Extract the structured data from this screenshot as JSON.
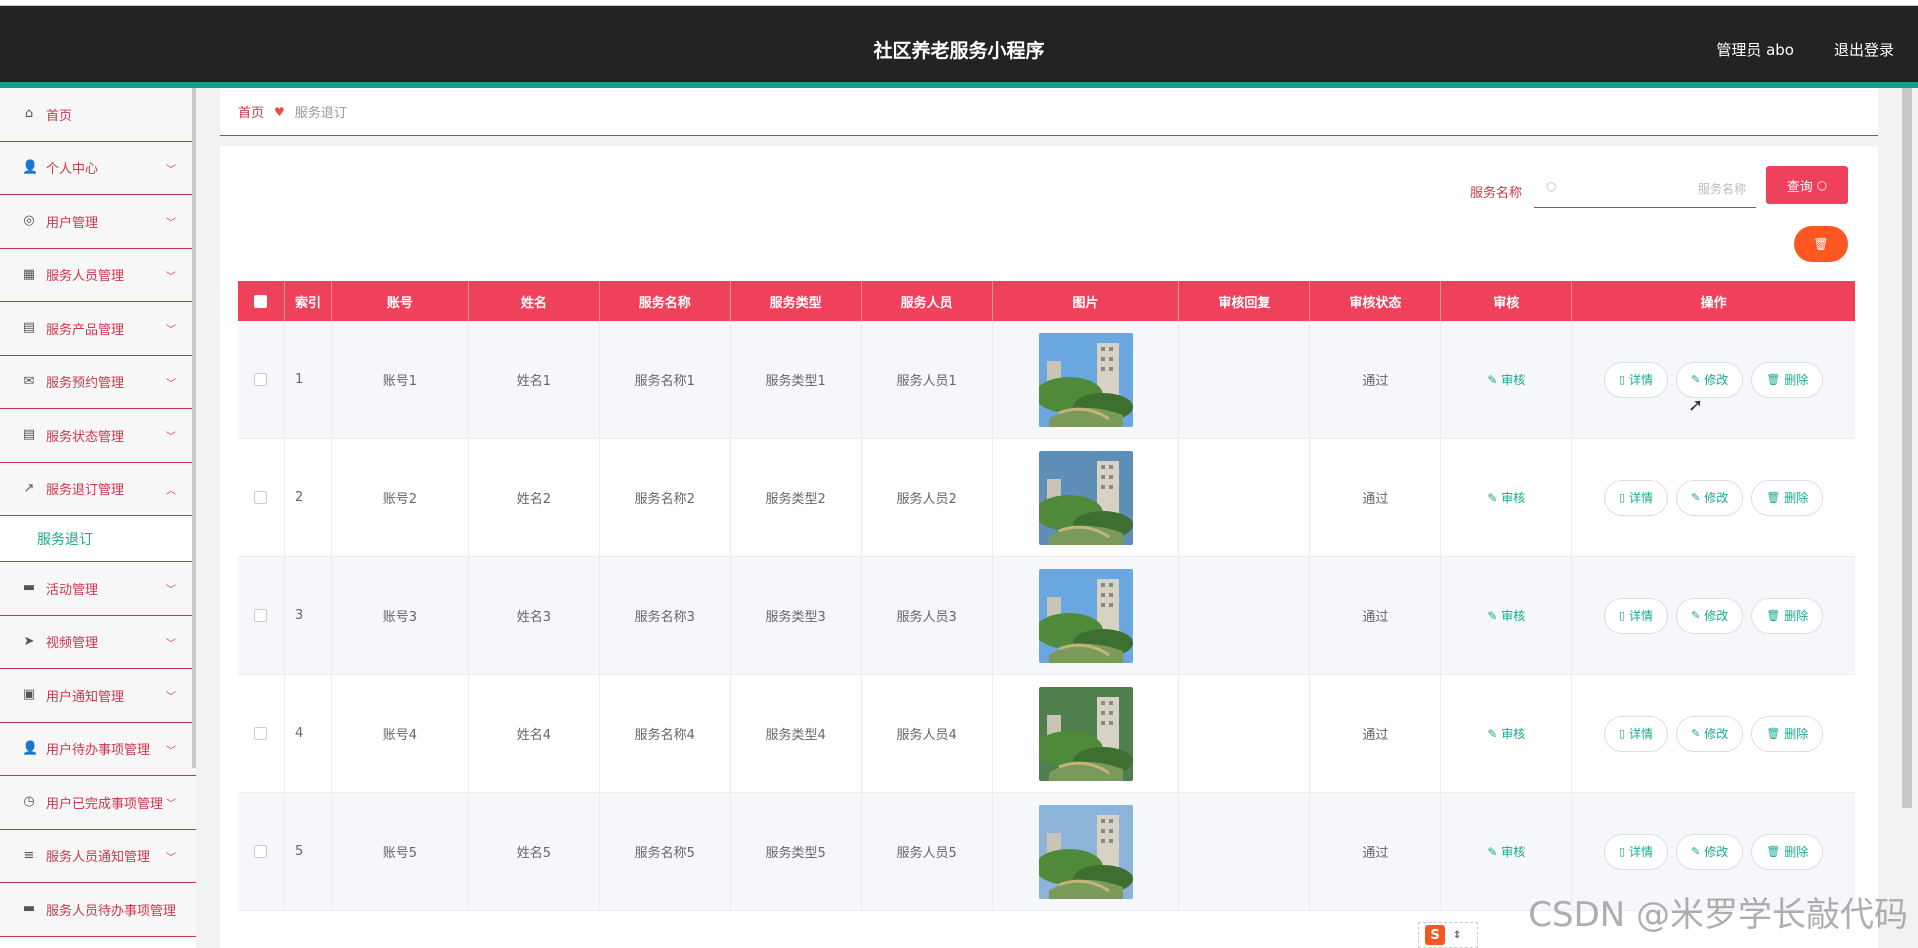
{
  "header": {
    "app_title": "社区养老服务小程序",
    "admin_label": "管理员 abo",
    "logout_label": "退出登录"
  },
  "sidebar": {
    "items": [
      {
        "label": "首页",
        "icon": "home-icon",
        "glyph": "⌂",
        "chevron": ""
      },
      {
        "label": "个人中心",
        "icon": "user-icon",
        "glyph": "👤",
        "chevron": "﹀"
      },
      {
        "label": "用户管理",
        "icon": "circle-user-icon",
        "glyph": "◎",
        "chevron": "﹀"
      },
      {
        "label": "服务人员管理",
        "icon": "briefcase-icon",
        "glyph": "▦",
        "chevron": "﹀"
      },
      {
        "label": "服务产品管理",
        "icon": "clipboard-icon",
        "glyph": "▤",
        "chevron": "﹀"
      },
      {
        "label": "服务预约管理",
        "icon": "mail-icon",
        "glyph": "✉",
        "chevron": "﹀"
      },
      {
        "label": "服务状态管理",
        "icon": "clipboard-list-icon",
        "glyph": "▤",
        "chevron": "﹀"
      },
      {
        "label": "服务退订管理",
        "icon": "chart-icon",
        "glyph": "↗",
        "chevron": "︿"
      }
    ],
    "active_submenu": "服务退订",
    "items_after": [
      {
        "label": "活动管理",
        "icon": "printer-icon",
        "glyph": "▬",
        "chevron": "﹀"
      },
      {
        "label": "视频管理",
        "icon": "send-icon",
        "glyph": "➤",
        "chevron": "﹀"
      },
      {
        "label": "用户通知管理",
        "icon": "delete-box-icon",
        "glyph": "▣",
        "chevron": "﹀"
      },
      {
        "label": "用户待办事项管理",
        "icon": "user-icon",
        "glyph": "👤",
        "chevron": "﹀"
      },
      {
        "label": "用户已完成事项管理",
        "icon": "clock-icon",
        "glyph": "◷",
        "chevron": "﹀"
      },
      {
        "label": "服务人员通知管理",
        "icon": "list-icon",
        "glyph": "≡",
        "chevron": "﹀"
      },
      {
        "label": "服务人员待办事项管理",
        "icon": "comment-icon",
        "glyph": "▬",
        "chevron": ""
      }
    ]
  },
  "breadcrumb": {
    "home": "首页",
    "current": "服务退订"
  },
  "search": {
    "label": "服务名称",
    "placeholder": "服务名称",
    "query_label": "查询"
  },
  "delete_fab_icon": "trash-icon",
  "table": {
    "headers": [
      "索引",
      "账号",
      "姓名",
      "服务名称",
      "服务类型",
      "服务人员",
      "图片",
      "审核回复",
      "审核状态",
      "审核",
      "操作"
    ],
    "rows": [
      {
        "index": "1",
        "account": "账号1",
        "name": "姓名1",
        "service": "服务名称1",
        "type": "服务类型1",
        "staff": "服务人员1",
        "reply": "",
        "status": "通过"
      },
      {
        "index": "2",
        "account": "账号2",
        "name": "姓名2",
        "service": "服务名称2",
        "type": "服务类型2",
        "staff": "服务人员2",
        "reply": "",
        "status": "通过"
      },
      {
        "index": "3",
        "account": "账号3",
        "name": "姓名3",
        "service": "服务名称3",
        "type": "服务类型3",
        "staff": "服务人员3",
        "reply": "",
        "status": "通过"
      },
      {
        "index": "4",
        "account": "账号4",
        "name": "姓名4",
        "service": "服务名称4",
        "type": "服务类型4",
        "staff": "服务人员4",
        "reply": "",
        "status": "通过"
      },
      {
        "index": "5",
        "account": "账号5",
        "name": "姓名5",
        "service": "服务名称5",
        "type": "服务类型5",
        "staff": "服务人员5",
        "reply": "",
        "status": "通过"
      }
    ],
    "audit_label": "审核",
    "ops": {
      "detail": "详情",
      "edit": "修改",
      "delete": "删除"
    }
  },
  "watermark": "CSDN @米罗学长敲代码",
  "colors": {
    "header_bg": "#232323",
    "accent_teal": "#179e8a",
    "primary_red": "#f0415c",
    "orange": "#ff5722",
    "link_teal": "#1aa88f"
  }
}
